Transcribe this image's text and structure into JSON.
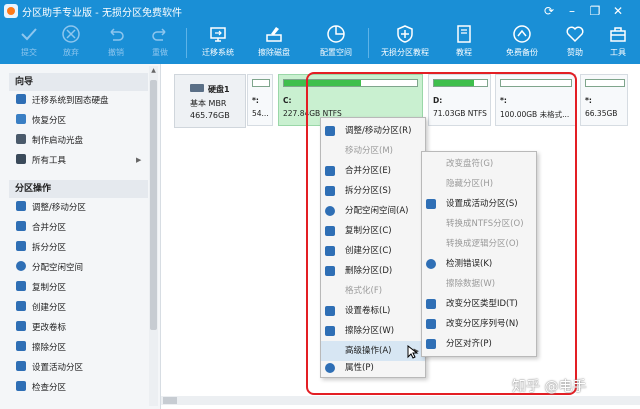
{
  "window": {
    "title": "分区助手专业版 - 无损分区免费软件",
    "controls": [
      "refresh-icon",
      "minimize-icon",
      "restore-icon",
      "close-icon"
    ]
  },
  "toolbar": {
    "items": [
      {
        "label": "提交",
        "icon": "check-icon",
        "enabled": false
      },
      {
        "label": "放弃",
        "icon": "cancel-circle-icon",
        "enabled": false
      },
      {
        "label": "撤销",
        "icon": "undo-icon",
        "enabled": false
      },
      {
        "label": "重做",
        "icon": "redo-icon",
        "enabled": false
      },
      {
        "label": "迁移系统",
        "icon": "migrate-os-icon",
        "enabled": true
      },
      {
        "label": "擦除磁盘",
        "icon": "wipe-disk-icon",
        "enabled": true
      },
      {
        "label": "配置空间",
        "icon": "allocate-space-icon",
        "enabled": true
      },
      {
        "label": "无损分区教程",
        "icon": "shield-icon",
        "enabled": true
      },
      {
        "label": "教程",
        "icon": "tutorial-icon",
        "enabled": true
      },
      {
        "label": "免费备份",
        "icon": "backup-icon",
        "enabled": true
      },
      {
        "label": "赞助",
        "icon": "heart-icon",
        "enabled": true
      },
      {
        "label": "工具",
        "icon": "toolbox-icon",
        "enabled": true
      }
    ]
  },
  "sidebar": {
    "wizard": {
      "title": "向导",
      "items": [
        {
          "label": "迁移系统到固态硬盘",
          "icon": "migrate-ssd-icon",
          "color": "#2f6fb5"
        },
        {
          "label": "恢复分区",
          "icon": "recover-icon",
          "color": "#3a7fc4"
        },
        {
          "label": "制作启动光盘",
          "icon": "boot-disc-icon",
          "color": "#4a5a6b"
        },
        {
          "label": "所有工具",
          "icon": "all-tools-icon",
          "color": "#3a4a5a",
          "has_submenu": true
        }
      ]
    },
    "partition_ops": {
      "title": "分区操作",
      "items": [
        {
          "label": "调整/移动分区",
          "icon": "resize-icon",
          "color": "#2f6fb5"
        },
        {
          "label": "合并分区",
          "icon": "merge-icon",
          "color": "#2f6fb5"
        },
        {
          "label": "拆分分区",
          "icon": "split-icon",
          "color": "#2f6fb5"
        },
        {
          "label": "分配空闲空间",
          "icon": "allocate-icon",
          "color": "#2f6fb5"
        },
        {
          "label": "复制分区",
          "icon": "copy-icon",
          "color": "#2f6fb5"
        },
        {
          "label": "创建分区",
          "icon": "create-icon",
          "color": "#2f6fb5"
        },
        {
          "label": "更改卷标",
          "icon": "label-icon",
          "color": "#2f6fb5"
        },
        {
          "label": "擦除分区",
          "icon": "wipe-icon",
          "color": "#2f6fb5"
        },
        {
          "label": "设置活动分区",
          "icon": "set-active-icon",
          "color": "#2f6fb5"
        },
        {
          "label": "检查分区",
          "icon": "check-partition-icon",
          "color": "#2f6fb5"
        }
      ]
    }
  },
  "disk": {
    "name": "硬盘1",
    "type": "基本 MBR",
    "size": "465.76GB",
    "partitions": [
      {
        "label": "*:",
        "info": "54...",
        "used_fraction": 0.0,
        "selected": false
      },
      {
        "label": "C:",
        "info": "227.84GB NTFS",
        "used_fraction": 0.58,
        "selected": true
      },
      {
        "label": "D:",
        "info": "71.03GB NTFS",
        "used_fraction": 0.75,
        "selected": false
      },
      {
        "label": "*:",
        "info": "100.00GB 未格式...",
        "used_fraction": 0.0,
        "selected": false
      },
      {
        "label": "*:",
        "info": "66.35GB",
        "used_fraction": 0.0,
        "selected": false
      }
    ]
  },
  "context_menu": {
    "items": [
      {
        "label": "调整/移动分区(R)",
        "icon": "resize-icon",
        "enabled": true
      },
      {
        "label": "移动分区(M)",
        "icon": "",
        "enabled": false
      },
      {
        "label": "合并分区(E)",
        "icon": "merge-icon",
        "enabled": true
      },
      {
        "label": "拆分分区(S)",
        "icon": "split-icon",
        "enabled": true
      },
      {
        "label": "分配空闲空间(A)",
        "icon": "allocate-icon",
        "enabled": true
      },
      {
        "label": "复制分区(C)",
        "icon": "copy-icon",
        "enabled": true
      },
      {
        "label": "创建分区(C)",
        "icon": "create-icon",
        "enabled": true
      },
      {
        "label": "删除分区(D)",
        "icon": "delete-icon",
        "enabled": true
      },
      {
        "label": "格式化(F)",
        "icon": "",
        "enabled": false
      },
      {
        "label": "设置卷标(L)",
        "icon": "label-icon",
        "enabled": true
      },
      {
        "label": "擦除分区(W)",
        "icon": "wipe-icon",
        "enabled": true
      },
      {
        "label": "高级操作(A)",
        "icon": "",
        "enabled": true,
        "has_submenu": true,
        "highlighted": true
      },
      {
        "label": "属性(P)",
        "icon": "info-icon",
        "enabled": true
      }
    ]
  },
  "submenu": {
    "items": [
      {
        "label": "改变盘符(G)",
        "icon": "",
        "enabled": false
      },
      {
        "label": "隐藏分区(H)",
        "icon": "",
        "enabled": false
      },
      {
        "label": "设置成活动分区(S)",
        "icon": "set-active-icon",
        "enabled": true
      },
      {
        "label": "转换成NTFS分区(O)",
        "icon": "",
        "enabled": false
      },
      {
        "label": "转换成逻辑分区(O)",
        "icon": "",
        "enabled": false
      },
      {
        "label": "检测错误(K)",
        "icon": "check-error-icon",
        "enabled": true
      },
      {
        "label": "擦除数据(W)",
        "icon": "",
        "enabled": false
      },
      {
        "label": "改变分区类型ID(T)",
        "icon": "id-icon",
        "enabled": true
      },
      {
        "label": "改变分区序列号(N)",
        "icon": "serial-icon",
        "enabled": true
      },
      {
        "label": "分区对齐(P)",
        "icon": "align-icon",
        "enabled": true
      }
    ]
  },
  "watermark": "知乎 @电手",
  "colors": {
    "titlebar": "#1a8fd6",
    "selected_partition": "#c9f0d0",
    "highlight_box": "#e31e24",
    "menu_hover": "#d7e6f3"
  }
}
